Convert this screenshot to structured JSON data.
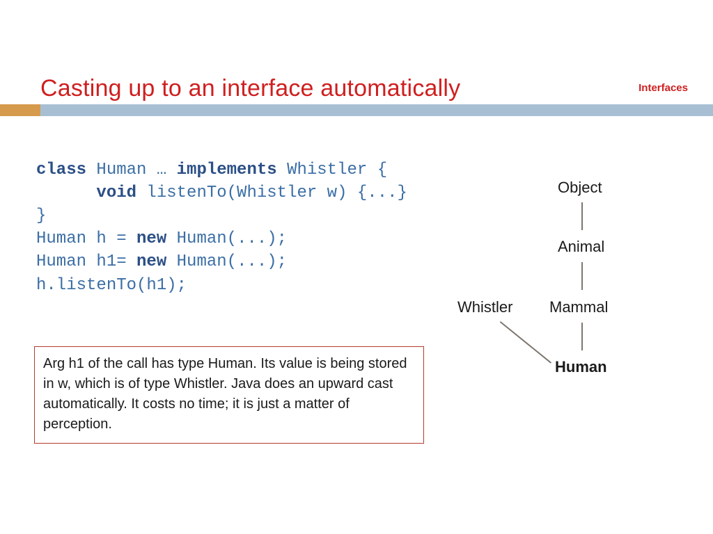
{
  "header": {
    "title": "Casting up to an interface automatically",
    "section": "Interfaces"
  },
  "code": {
    "l1_kw1": "class",
    "l1_t1": " Human … ",
    "l1_kw2": "implements",
    "l1_t2": " Whistler {",
    "l2_pre": "      ",
    "l2_kw": "void",
    "l2_t": " listenTo(Whistler w) {...}",
    "l3": "}",
    "l4_pre": "Human h = ",
    "l4_kw": "new",
    "l4_t": " Human(...);",
    "l5_pre": "Human h1= ",
    "l5_kw": "new",
    "l5_t": " Human(...);",
    "l6": "h.listenTo(h1);"
  },
  "note": "Arg h1 of the call has type Human. Its value is being stored in w, which is of type Whistler. Java does an upward cast automatically. It costs no time; it is just a matter of perception.",
  "diagram": {
    "object": "Object",
    "animal": "Animal",
    "whistler": "Whistler",
    "mammal": "Mammal",
    "human": "Human"
  }
}
